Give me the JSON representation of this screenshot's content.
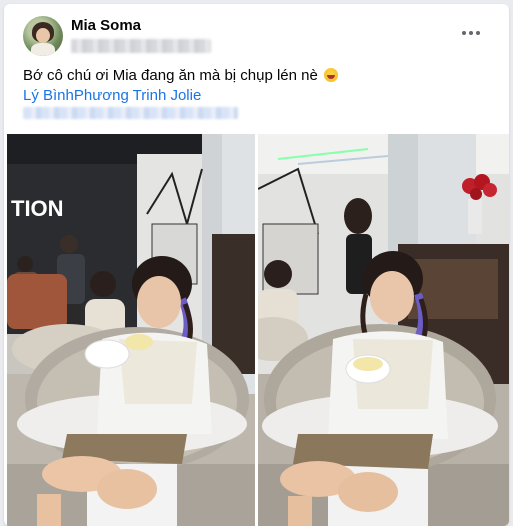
{
  "post": {
    "author": "Mia Soma",
    "caption": "Bớ cô chú ơi Mia đang ăn mà bị chụp lén nè",
    "caption_emoji": "rolling-on-floor-laughing-emoji",
    "tagged": [
      "Lý Bình",
      "Phương Trinh Jolie"
    ],
    "sign_text": "TION"
  },
  "colors": {
    "link": "#1b74e4",
    "text": "#050505",
    "card": "#ffffff",
    "page_bg": "#e9ebee"
  }
}
